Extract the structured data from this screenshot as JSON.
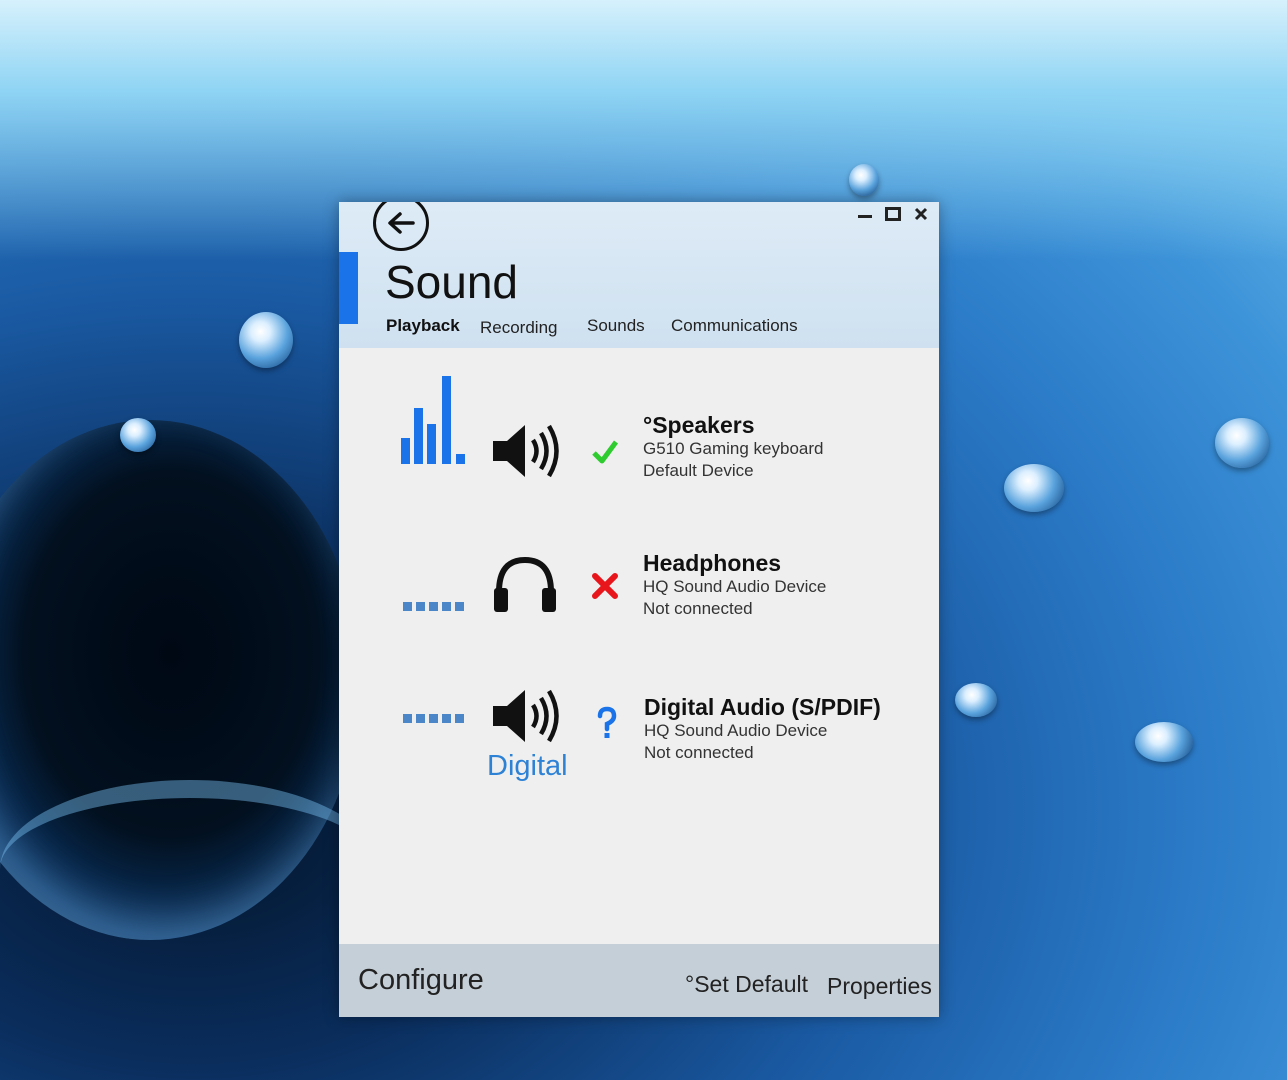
{
  "window": {
    "title": "Sound",
    "controls": {
      "minimize": "minimize-icon",
      "maximize": "maximize-icon",
      "close": "close-icon"
    },
    "back_icon": "arrow-left-icon"
  },
  "tabs": [
    {
      "label": "Playback",
      "active": true
    },
    {
      "label": "Recording",
      "active": false
    },
    {
      "label": "Sounds",
      "active": false
    },
    {
      "label": "Communications",
      "active": false
    }
  ],
  "devices": [
    {
      "name": "°Speakers",
      "line1": "G510 Gaming keyboard",
      "line2": "Default Device",
      "icon": "speaker-icon",
      "status_icon": "check-icon",
      "status_color": "#2ecc2e"
    },
    {
      "name": "Headphones",
      "line1": "HQ Sound Audio Device",
      "line2": "Not connected",
      "icon": "headphones-icon",
      "status_icon": "x-icon",
      "status_color": "#e8151b"
    },
    {
      "name": "Digital Audio (S/PDIF)",
      "line1": "HQ Sound Audio Device",
      "line2": "Not connected",
      "icon": "speaker-icon",
      "status_icon": "question-icon",
      "status_color": "#1a73e8",
      "sublabel": "Digital"
    }
  ],
  "footer": {
    "configure": "Configure",
    "set_default": "°Set Default",
    "properties": "Properties"
  },
  "colors": {
    "accent": "#1a73e8",
    "level_bars": "#1a73e8",
    "digital_label": "#2e82d6"
  }
}
